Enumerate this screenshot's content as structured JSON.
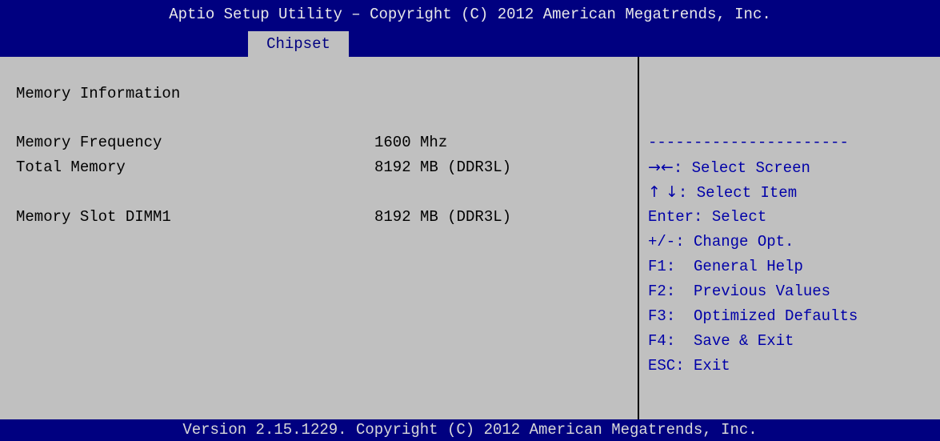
{
  "header": {
    "title": "Aptio Setup Utility – Copyright (C) 2012 American Megatrends, Inc.",
    "active_tab": "Chipset"
  },
  "main": {
    "section_title": "Memory Information",
    "rows": [
      {
        "label": "Memory Frequency",
        "value": "1600 Mhz"
      },
      {
        "label": "Total Memory",
        "value": "8192 MB (DDR3L)"
      },
      {
        "label": "Memory Slot DIMM1",
        "value": "8192 MB (DDR3L)"
      }
    ]
  },
  "help": {
    "separator": "----------------------",
    "items": [
      {
        "key": "→←",
        "text": ": Select Screen"
      },
      {
        "key": "↑ ↓",
        "text": ": Select Item"
      },
      {
        "key": "Enter",
        "text": ": Select"
      },
      {
        "key": "+/-",
        "text": ": Change Opt."
      },
      {
        "key": "F1",
        "text": ":  General Help"
      },
      {
        "key": "F2",
        "text": ":  Previous Values"
      },
      {
        "key": "F3",
        "text": ":  Optimized Defaults"
      },
      {
        "key": "F4",
        "text": ":  Save & Exit"
      },
      {
        "key": "ESC",
        "text": ": Exit"
      }
    ]
  },
  "footer": {
    "text": "Version 2.15.1229. Copyright (C) 2012 American Megatrends, Inc."
  },
  "colors": {
    "header_bg": "#000080",
    "panel_bg": "#c0c0c0",
    "help_text": "#0000a8"
  }
}
